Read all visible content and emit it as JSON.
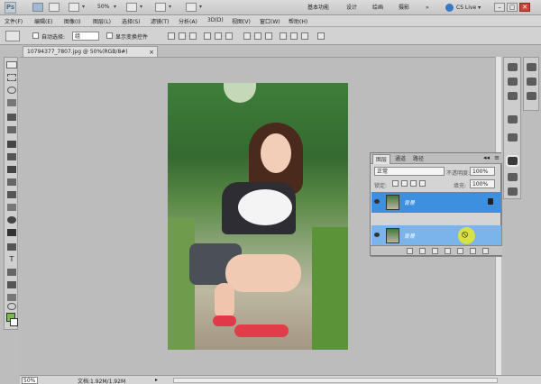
{
  "app": {
    "logo_text": "Ps"
  },
  "topbar": {
    "zoom": "50%",
    "workspace_items": [
      "基本功能",
      "设计",
      "绘画",
      "摄影"
    ],
    "more": "»",
    "cslive": "CS Live ▾",
    "window_buttons": [
      "–",
      "▢",
      "✕"
    ]
  },
  "menu": {
    "items": [
      "文件(F)",
      "编辑(E)",
      "图像(I)",
      "图层(L)",
      "选择(S)",
      "滤镜(T)",
      "分析(A)",
      "3D(D)",
      "视图(V)",
      "窗口(W)",
      "帮助(H)"
    ]
  },
  "options": {
    "auto_select_label": "自动选择:",
    "auto_select_value": "组",
    "show_transform_label": "显示变换控件"
  },
  "document": {
    "tab_title": "10794377_7807.jpg @ 50%(RGB/8#)",
    "close": "×"
  },
  "layers_panel": {
    "tabs": [
      "图层",
      "通道",
      "路径"
    ],
    "menu_icon": "≡",
    "collapse_icon": "◂◂",
    "blend_mode": "正常",
    "opacity_label": "不透明度:",
    "opacity_value": "100%",
    "lock_label": "锁定:",
    "fill_label": "填充:",
    "fill_value": "100%",
    "layers": [
      {
        "name": "背景",
        "state": "selected",
        "locked": true
      },
      {
        "name": "背景",
        "state": "dragging",
        "locked": false
      }
    ]
  },
  "status": {
    "zoom": "50%",
    "doc_info": "文档:1.92M/1.92M",
    "arrow": "▸"
  },
  "colors": {
    "accent": "#3d8fe0",
    "foreground_swatch": "#7bb55a",
    "background_swatch": "#ffffff"
  }
}
